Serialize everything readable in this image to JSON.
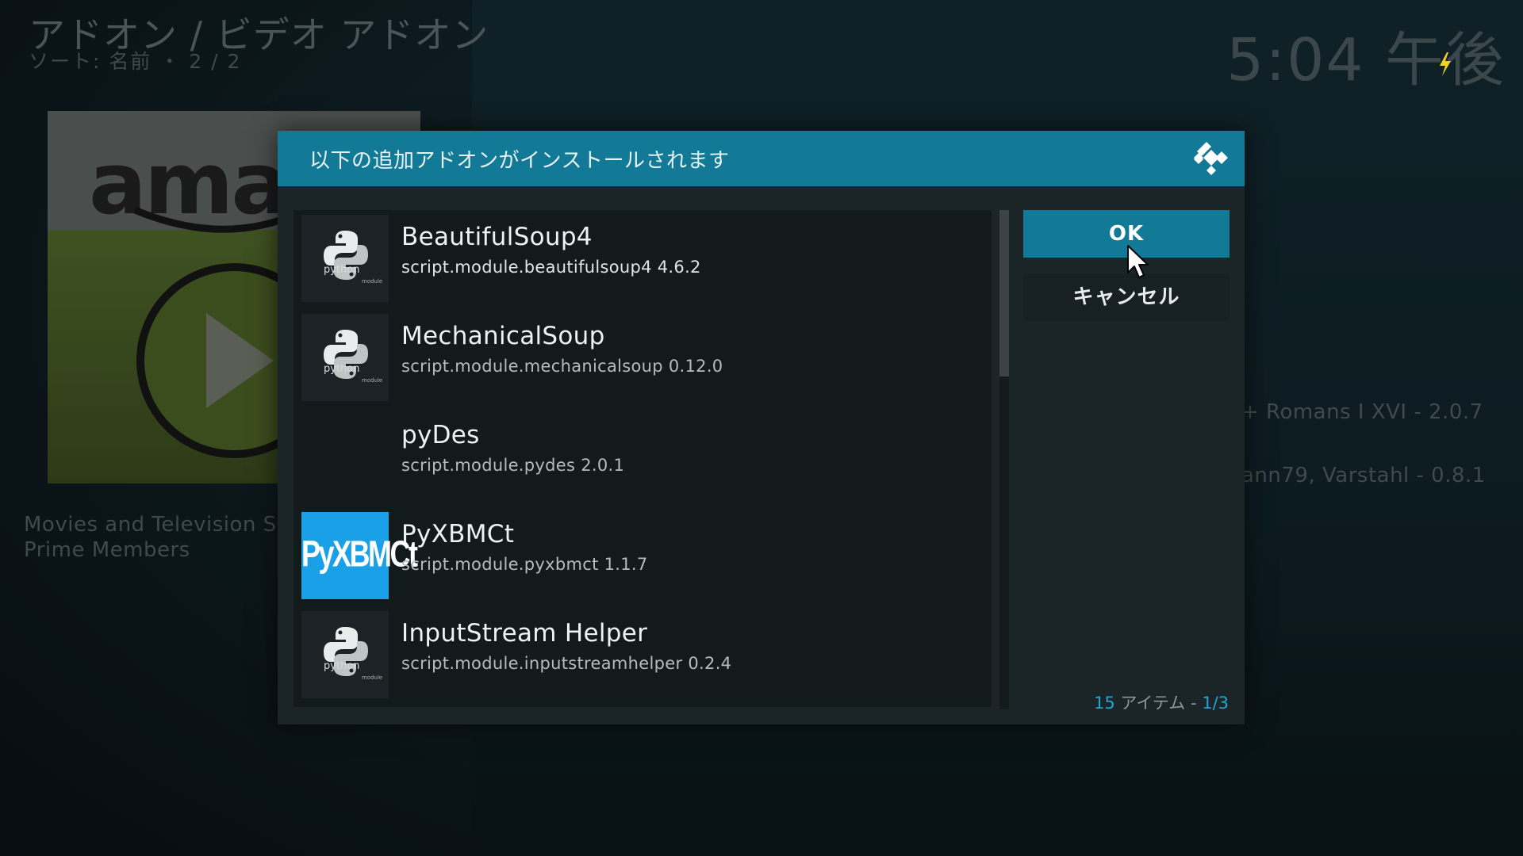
{
  "header": {
    "title": "アドオン / ビデオ アドオン",
    "subtitle": "ソート: 名前 ・ 2 / 2",
    "clock": "5:04 午後"
  },
  "background": {
    "poster_wordmark": "amaz",
    "description_line1": "Movies and Television S",
    "description_line2": "Prime Members",
    "right_line1": "+ Romans I XVI - 2.0.7",
    "right_line2": "ann79, Varstahl - 0.8.1"
  },
  "dialog": {
    "title": "以下の追加アドオンがインストールされます",
    "ok_label": "OK",
    "cancel_label": "キャンセル",
    "count_number": "15",
    "count_text": " アイテム - ",
    "count_page": "1/3",
    "items": [
      {
        "name": "BeautifulSoup4",
        "id": "script.module.beautifulsoup4 4.6.2",
        "icon": "python-module-icon",
        "python_caption": "python",
        "module_caption": "module"
      },
      {
        "name": "MechanicalSoup",
        "id": "script.module.mechanicalsoup 0.12.0",
        "icon": "python-module-icon",
        "python_caption": "python",
        "module_caption": "module"
      },
      {
        "name": "pyDes",
        "id": "script.module.pydes 2.0.1",
        "icon": "none"
      },
      {
        "name": "PyXBMCt",
        "id": "script.module.pyxbmct 1.1.7",
        "icon": "pyxbmct-logo-icon",
        "logo_text": "PyXBMCt"
      },
      {
        "name": "InputStream Helper",
        "id": "script.module.inputstreamhelper 0.2.4",
        "icon": "python-module-icon",
        "python_caption": "python",
        "module_caption": "module"
      }
    ]
  },
  "colors": {
    "accent": "#127a96",
    "count_highlight": "#1ea7d1",
    "bolt": "#f5d020"
  }
}
